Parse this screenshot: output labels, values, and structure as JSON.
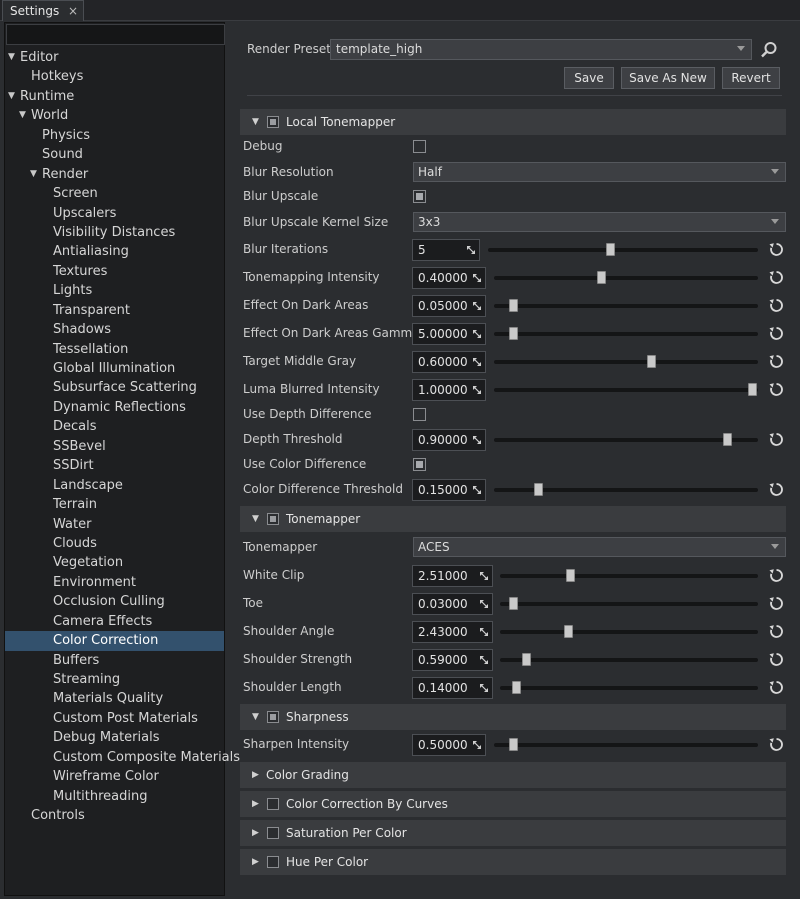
{
  "tab": {
    "label": "Settings",
    "close": "×"
  },
  "tree": [
    {
      "label": "Editor",
      "level": 0,
      "expand": "down"
    },
    {
      "label": "Hotkeys",
      "level": 1
    },
    {
      "label": "Runtime",
      "level": 0,
      "expand": "down"
    },
    {
      "label": "World",
      "level": 1,
      "expand": "down"
    },
    {
      "label": "Physics",
      "level": 2
    },
    {
      "label": "Sound",
      "level": 2
    },
    {
      "label": "Render",
      "level": 2,
      "expand": "down"
    },
    {
      "label": "Screen",
      "level": 3
    },
    {
      "label": "Upscalers",
      "level": 3
    },
    {
      "label": "Visibility Distances",
      "level": 3
    },
    {
      "label": "Antialiasing",
      "level": 3
    },
    {
      "label": "Textures",
      "level": 3
    },
    {
      "label": "Lights",
      "level": 3
    },
    {
      "label": "Transparent",
      "level": 3
    },
    {
      "label": "Shadows",
      "level": 3
    },
    {
      "label": "Tessellation",
      "level": 3
    },
    {
      "label": "Global Illumination",
      "level": 3
    },
    {
      "label": "Subsurface Scattering",
      "level": 3
    },
    {
      "label": "Dynamic Reflections",
      "level": 3
    },
    {
      "label": "Decals",
      "level": 3
    },
    {
      "label": "SSBevel",
      "level": 3
    },
    {
      "label": "SSDirt",
      "level": 3
    },
    {
      "label": "Landscape",
      "level": 3
    },
    {
      "label": "Terrain",
      "level": 3
    },
    {
      "label": "Water",
      "level": 3
    },
    {
      "label": "Clouds",
      "level": 3
    },
    {
      "label": "Vegetation",
      "level": 3
    },
    {
      "label": "Environment",
      "level": 3
    },
    {
      "label": "Occlusion Culling",
      "level": 3
    },
    {
      "label": "Camera Effects",
      "level": 3
    },
    {
      "label": "Color Correction",
      "level": 3,
      "selected": true
    },
    {
      "label": "Buffers",
      "level": 3
    },
    {
      "label": "Streaming",
      "level": 3
    },
    {
      "label": "Materials Quality",
      "level": 3
    },
    {
      "label": "Custom Post Materials",
      "level": 3
    },
    {
      "label": "Debug Materials",
      "level": 3
    },
    {
      "label": "Custom Composite Materials",
      "level": 3
    },
    {
      "label": "Wireframe Color",
      "level": 3
    },
    {
      "label": "Multithreading",
      "level": 3
    },
    {
      "label": "Controls",
      "level": 1
    }
  ],
  "preset": {
    "label": "Render Preset:",
    "value": "template_high",
    "save": "Save",
    "save_as_new": "Save As New",
    "revert": "Revert"
  },
  "local_tonemapper": {
    "title": "Local Tonemapper",
    "debug": "Debug",
    "blur_resolution": {
      "label": "Blur Resolution",
      "value": "Half"
    },
    "blur_upscale": "Blur Upscale",
    "blur_upscale_kernel": {
      "label": "Blur Upscale Kernel Size",
      "value": "3x3"
    },
    "blur_iterations": {
      "label": "Blur Iterations",
      "value": "5"
    },
    "tonemapping_intensity": {
      "label": "Tonemapping Intensity",
      "value": "0.40000"
    },
    "effect_dark": {
      "label": "Effect On Dark Areas",
      "value": "0.05000"
    },
    "effect_dark_gamma": {
      "label": "Effect On Dark Areas Gamma",
      "value": "5.00000"
    },
    "target_middle_gray": {
      "label": "Target Middle Gray",
      "value": "0.60000"
    },
    "luma_blurred": {
      "label": "Luma Blurred Intensity",
      "value": "1.00000"
    },
    "use_depth": "Use Depth Difference",
    "depth_threshold": {
      "label": "Depth  Threshold",
      "value": "0.90000"
    },
    "use_color": "Use Color Difference",
    "color_threshold": {
      "label": "Color Difference Threshold",
      "value": "0.15000"
    }
  },
  "tonemapper": {
    "title": "Tonemapper",
    "type": {
      "label": "Tonemapper",
      "value": "ACES"
    },
    "white_clip": {
      "label": "White Clip",
      "value": "2.51000"
    },
    "toe": {
      "label": "Toe",
      "value": "0.03000"
    },
    "shoulder_angle": {
      "label": "Shoulder Angle",
      "value": "2.43000"
    },
    "shoulder_strength": {
      "label": "Shoulder Strength",
      "value": "0.59000"
    },
    "shoulder_length": {
      "label": "Shoulder Length",
      "value": "0.14000"
    }
  },
  "sharpness": {
    "title": "Sharpness",
    "sharpen": {
      "label": "Sharpen Intensity",
      "value": "0.50000"
    }
  },
  "collapsed": {
    "color_grading": "Color Grading",
    "curves": "Color Correction By Curves",
    "saturation": "Saturation Per Color",
    "hue": "Hue Per Color"
  },
  "slider_levels": {
    "blur_iterations": 0.45,
    "tonemapping_intensity": 0.4,
    "effect_dark": 0.05,
    "effect_dark_gamma": 0.05,
    "target_middle_gray": 0.6,
    "luma_blurred": 1.0,
    "depth_threshold": 0.9,
    "color_threshold": 0.15,
    "white_clip": 0.26,
    "toe": 0.03,
    "shoulder_angle": 0.25,
    "shoulder_strength": 0.08,
    "shoulder_length": 0.04,
    "sharpen": 0.05
  }
}
